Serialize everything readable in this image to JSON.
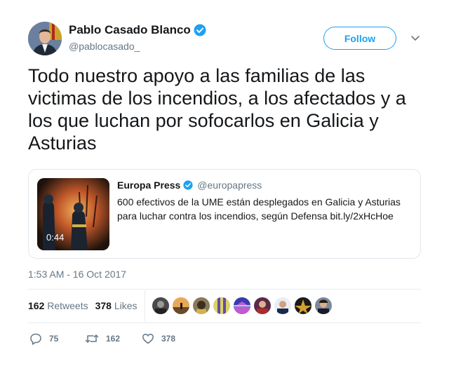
{
  "author": {
    "name": "Pablo Casado Blanco",
    "handle": "@pablocasado_",
    "verified_icon": "verified-badge-icon"
  },
  "follow_label": "Follow",
  "tweet_text": "Todo nuestro apoyo a las familias de las victimas de los incendios, a los afectados y a los que luchan por sofocarlos en Galicia y Asturias",
  "quoted": {
    "name": "Europa Press",
    "handle": "@europapress",
    "text": "600 efectivos de la UME están desplegados en Galicia y Asturias para luchar contra los incendios, según Defensa bit.ly/2xHcHoe",
    "video_duration": "0:44"
  },
  "timestamp": "1:53 AM - 16 Oct 2017",
  "stats": {
    "retweets_count": "162",
    "retweets_label": "Retweets",
    "likes_count": "378",
    "likes_label": "Likes"
  },
  "actions": {
    "reply_count": "75",
    "retweet_count": "162",
    "like_count": "378"
  },
  "colors": {
    "accent": "#1da1f2",
    "text": "#14171a",
    "secondary": "#657786"
  }
}
